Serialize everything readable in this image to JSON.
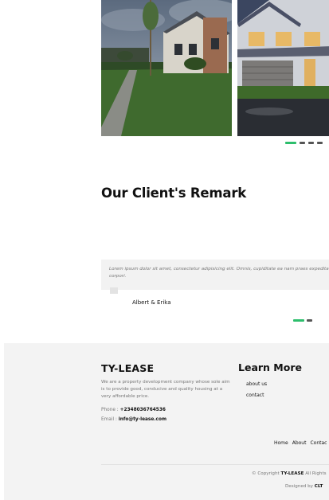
{
  "gallery": {
    "photos": [
      "house-photo-suburban-street",
      "house-photo-garage-evening"
    ],
    "pager_count": 4
  },
  "remarks": {
    "title": "Our Client's Remark",
    "quote": "Lorem ipsum dolor sit amet, consectetur adipisicing elit. Omnis, cupiditate ea nam praes expedita corpori.",
    "author": "Albert & Erika"
  },
  "footer": {
    "brand": "TY-LEASE",
    "about": "We are a property development company whose sole aim is to provide good, conducive and quality housing at a very affordable price.",
    "phone_label": "Phone :",
    "phone": "+2348036764536",
    "email_label": "Email :",
    "email": "info@ty-lease.com",
    "learn_more_title": "Learn More",
    "learn_more_links": [
      "about us",
      "contact"
    ],
    "nav": [
      "Home",
      "About",
      "Contac"
    ],
    "copyright_prefix": "© Copyright",
    "copyright_brand": "TY-LEASE",
    "copyright_suffix": "All Rights",
    "designed_prefix": "Designed by",
    "designed_by": "CLT"
  },
  "colors": {
    "accent": "#2dbe6c",
    "inactive_dot": "#555555",
    "footer_bg": "#f3f3f3"
  }
}
